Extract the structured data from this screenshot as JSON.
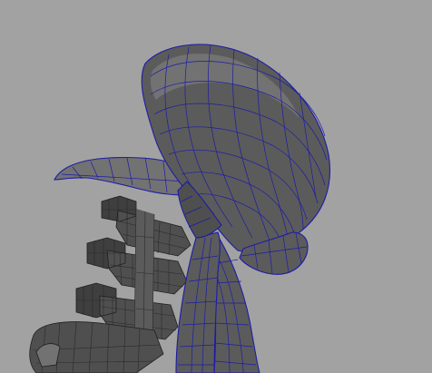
{
  "viewport": {
    "background_color": "#a2a2a2",
    "wireframe_color": "#1c1ca6",
    "mesh_color": "#5b5b5b"
  },
  "scene": {
    "objects": [
      {
        "name": "head-shell",
        "selected": true
      },
      {
        "name": "front-tentacle",
        "selected": true
      },
      {
        "name": "rear-tentacle",
        "selected": true
      },
      {
        "name": "spine-vertebrae",
        "selected": false
      }
    ]
  }
}
